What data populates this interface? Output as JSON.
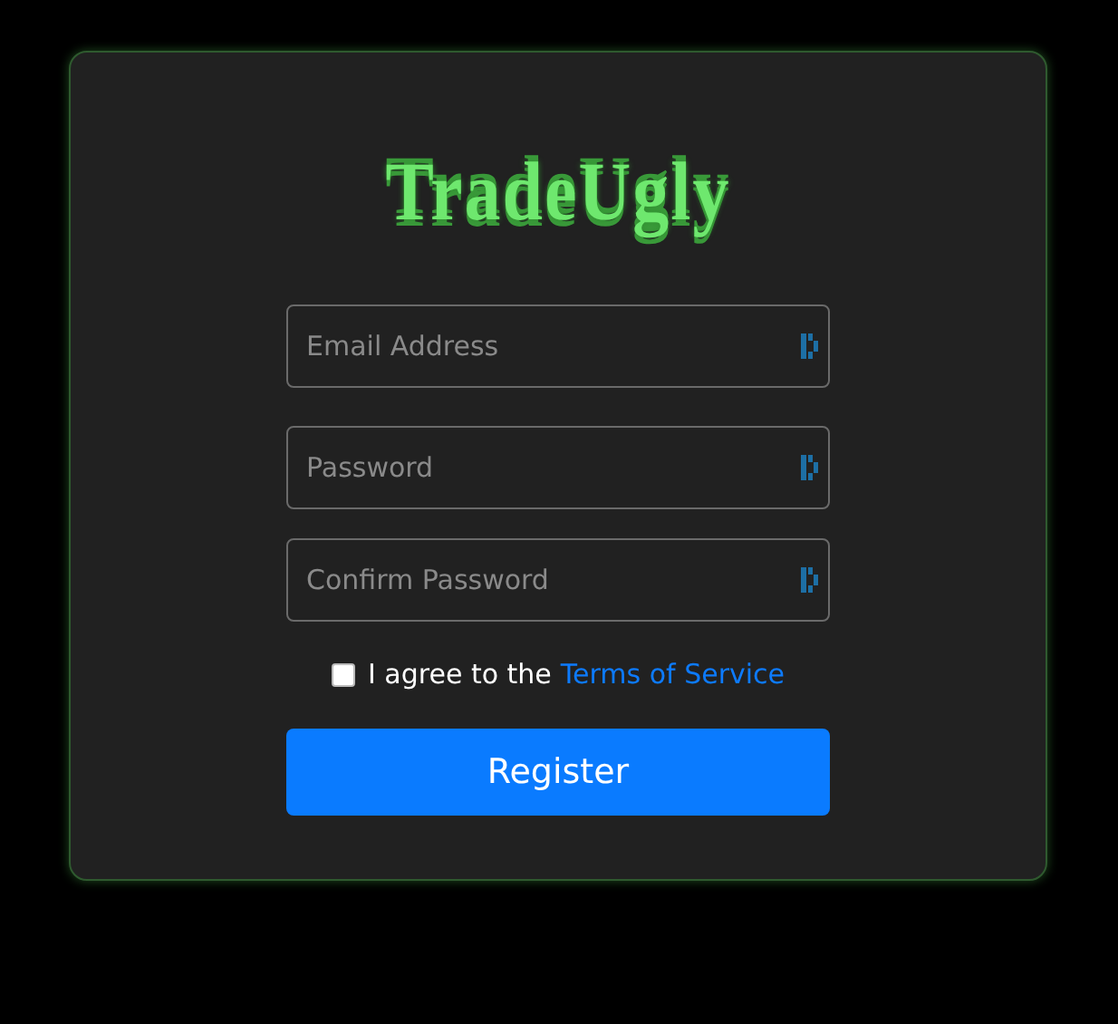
{
  "logo": {
    "text": "TradeUgly"
  },
  "fields": [
    {
      "placeholder": "Email Address"
    },
    {
      "placeholder": "Password"
    },
    {
      "placeholder": "Confirm Password"
    }
  ],
  "agreement": {
    "checked": false,
    "text": "I agree to the",
    "link": "Terms of Service"
  },
  "submit": {
    "label": "Register"
  }
}
